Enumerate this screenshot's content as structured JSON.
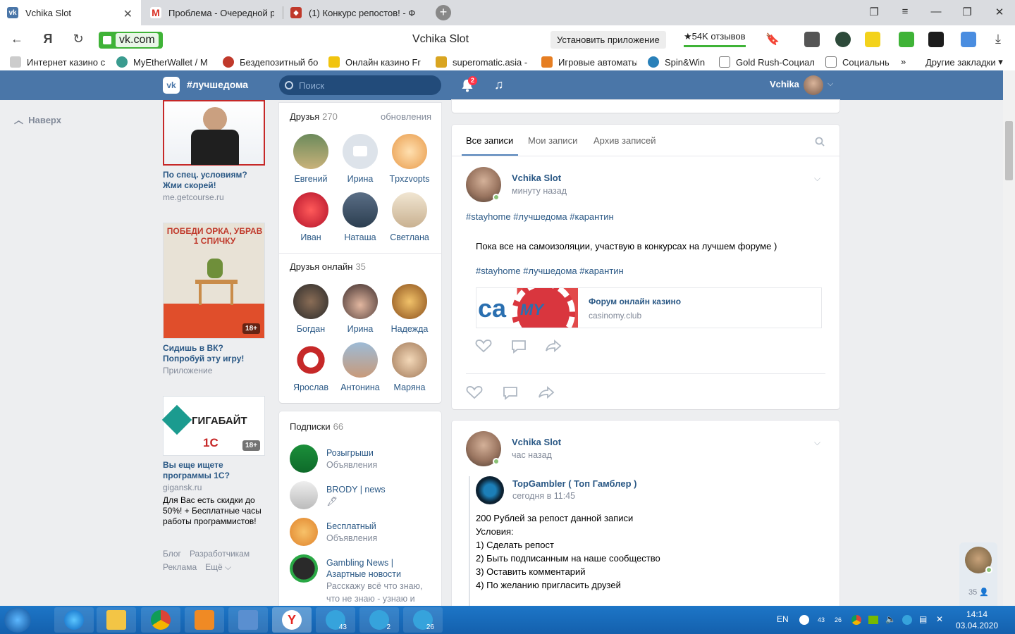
{
  "browser": {
    "tabs": [
      {
        "title": "Vchika Slot",
        "active": true
      },
      {
        "title": "Проблема - Очередной р",
        "active": false
      },
      {
        "title": "(1) Конкурс репостов! - Ф",
        "active": false
      }
    ],
    "address": "vk.com",
    "page_title": "Vchika Slot",
    "install_label": "Установить приложение",
    "reviews_label": "★54K отзывов",
    "bookmarks": [
      "Интернет казино с",
      "MyEtherWallet / М",
      "Бездепозитный бо",
      "Онлайн казино Fr",
      "superomatic.asia -",
      "Игровые автоматы",
      "Spin&Win",
      "Gold Rush-Социал",
      "Социальны",
      "Другие закладки"
    ]
  },
  "vk": {
    "header_hashtag": "#лучшедома",
    "search_placeholder": "Поиск",
    "notifications_count": "2",
    "user_name": "Vchika",
    "back_to_top": "Наверх",
    "ads": [
      {
        "title": "По спец. условиям? Жми скорей!",
        "domain": "me.getcourse.ru"
      },
      {
        "title": "Сидишь в ВК? Попробуй эту игру!",
        "domain": "Приложение",
        "image_text": "ПОБЕДИ ОРКА, УБРАВ 1 СПИЧКУ",
        "age": "18+"
      },
      {
        "title": "Вы еще ищете программы 1С?",
        "domain": "gigansk.ru",
        "desc": "Для Вас есть скидки до 50%! + Бесплатные часы работы программистов!",
        "image_text": "ГИГАБАЙТ",
        "image_sub": "1С",
        "age": "18+"
      }
    ],
    "footer_links": [
      "Блог",
      "Разработчикам",
      "Реклама",
      "Ещё ⌵"
    ],
    "friends": {
      "label": "Друзья",
      "count": "270",
      "updates": "обновления",
      "items": [
        "Евгений",
        "Ирина",
        "Tpxzvopts",
        "Иван",
        "Наташа",
        "Светлана"
      ]
    },
    "friends_online": {
      "label": "Друзья онлайн",
      "count": "35",
      "items": [
        "Богдан",
        "Ирина",
        "Надежда",
        "Ярослав",
        "Антонина",
        "Маряна"
      ]
    },
    "subscriptions": {
      "label": "Подписки",
      "count": "66",
      "items": [
        {
          "name": "Розыгрыши",
          "desc": "Объявления"
        },
        {
          "name": "BRODY | news",
          "desc": "🖋"
        },
        {
          "name": "Бесплатный",
          "desc": "Объявления"
        },
        {
          "name": "Gambling News | Азартные новости",
          "desc": "Расскажу всё что знаю, что не знаю - узнаю и"
        }
      ]
    },
    "feed_tabs": [
      "Все записи",
      "Мои записи",
      "Архив записей"
    ],
    "post1": {
      "author": "Vchika Slot",
      "time": "минуту назад",
      "tags": "#stayhome #лучшедома #карантин",
      "repost_text": "Пока все на самоизоляции, участвую в конкурсах на лучшем форуме )",
      "repost_tags": "#stayhome #лучшедома #карантин",
      "link_title": "Форум онлайн казино",
      "link_domain": "casinomy.club"
    },
    "post2": {
      "author": "Vchika Slot",
      "time": "час назад",
      "repost_author": "TopGambler ( Топ Гамблер )",
      "repost_time": "сегодня в 11:45",
      "lines": [
        "200 Рублей за репост данной записи",
        "Условия:",
        "1) Сделать репост",
        "2) Быть подписанным на наше сообщество",
        "3) Оставить комментарий",
        "4) По желанию пригласить друзей"
      ]
    },
    "chat_count": "35"
  },
  "taskbar": {
    "badges": [
      "43",
      "2",
      "26"
    ],
    "lang": "EN",
    "tray_badges": [
      "43",
      "26"
    ],
    "time": "14:14",
    "date": "03.04.2020"
  }
}
